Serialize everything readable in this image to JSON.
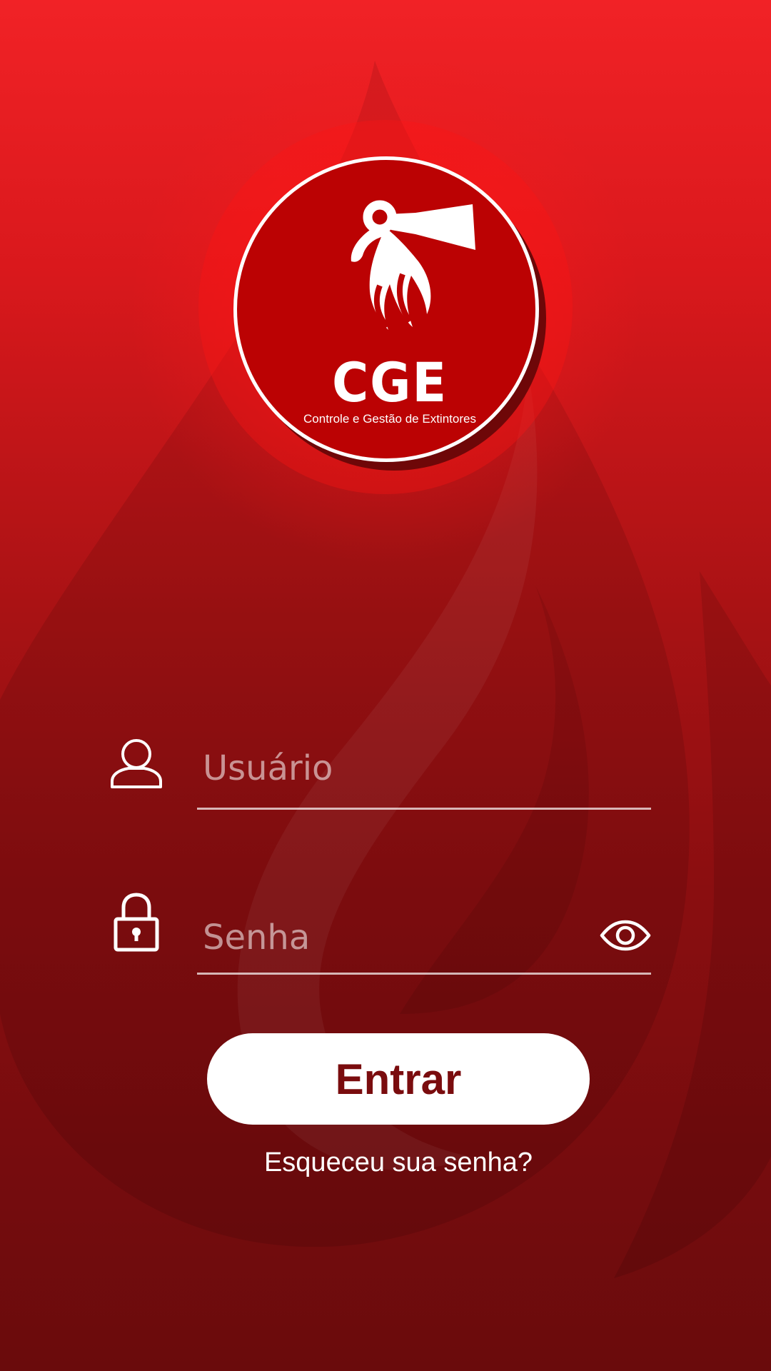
{
  "brand": {
    "name": "CGE",
    "tagline": "Controle e Gestão de Extintores",
    "logo_icon": "fire-extinguisher-icon"
  },
  "login_form": {
    "username": {
      "placeholder": "Usuário",
      "value": "",
      "icon": "user-icon"
    },
    "password": {
      "placeholder": "Senha",
      "value": "",
      "icon": "lock-icon",
      "toggle_icon": "eye-icon"
    },
    "submit_label": "Entrar",
    "forgot_label": "Esqueceu sua senha?"
  },
  "colors": {
    "background_top": "#f12226",
    "background_bottom": "#6a0b0c",
    "logo_red": "#bb0203",
    "button_text": "#7a0c0e",
    "white": "#ffffff"
  }
}
